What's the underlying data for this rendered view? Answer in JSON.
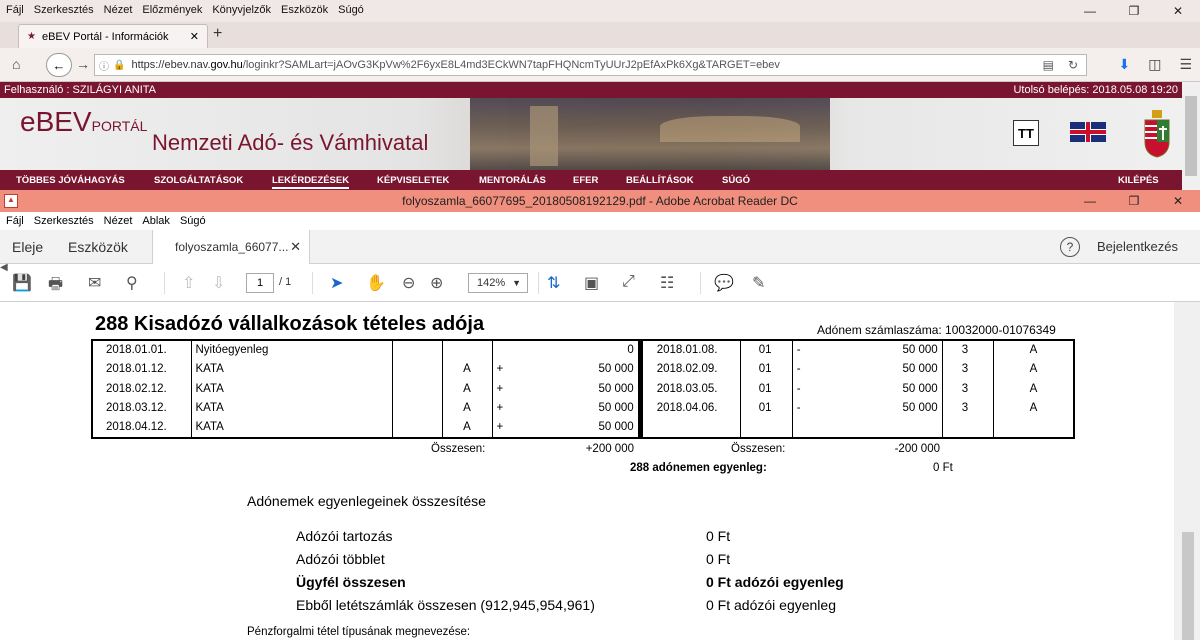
{
  "firefox": {
    "menu": [
      "Fájl",
      "Szerkesztés",
      "Nézet",
      "Előzmények",
      "Könyvjelzők",
      "Eszközök",
      "Súgó"
    ],
    "tab_title": "eBEV Portál - Információk",
    "url_prefix": "https://ebev.nav.",
    "url_host": "gov.hu",
    "url_rest": "/loginkr?SAMLart=jAOvG3KpVw%2F6yxE8L4md3ECkWN7tapFHQNcmTyUUrJ2pEfAxPk6Xg&TARGET=ebev"
  },
  "portal": {
    "user": "Felhasználó : SZILÁGYI ANITA",
    "last_login": "Utolsó belépés: 2018.05.08 19:20",
    "logo_main": "eBEV",
    "logo_sub": "PORTÁL",
    "agency": "Nemzeti Adó- és Vámhivatal",
    "font_button": "TT",
    "menu": [
      "TÖBBES JÓVÁHAGYÁS",
      "SZOLGÁLTATÁSOK",
      "LEKÉRDEZÉSEK",
      "KÉPVISELETEK",
      "MENTORÁLÁS",
      "EFER",
      "BEÁLLÍTÁSOK",
      "SÚGÓ"
    ],
    "logout": "KILÉPÉS",
    "accent": "#7a1530"
  },
  "acrobat": {
    "title": "folyoszamla_66077695_20180508192129.pdf - Adobe Acrobat Reader DC",
    "menu": [
      "Fájl",
      "Szerkesztés",
      "Nézet",
      "Ablak",
      "Súgó"
    ],
    "home": "Eleje",
    "tools": "Eszközök",
    "doc_tab": "folyoszamla_66077...",
    "login": "Bejelentkezés",
    "page_current": "1",
    "page_total": "/ 1",
    "zoom": "142%",
    "titlebar_color": "#f08f7e"
  },
  "document": {
    "title": "288 Kisadózó vállalkozások tételes adója",
    "account": "Adónem számlaszáma: 10032000-01076349",
    "rows": [
      {
        "date": "2018.01.01.",
        "desc": "Nyitóegyenleg",
        "a": "",
        "sign": "",
        "amount": "0",
        "date2": "2018.01.08.",
        "code": "01",
        "sign2": "-",
        "amount2": "50 000",
        "n": "3",
        "a2": "A"
      },
      {
        "date": "2018.01.12.",
        "desc": "KATA",
        "a": "A",
        "sign": "+",
        "amount": "50 000",
        "date2": "2018.02.09.",
        "code": "01",
        "sign2": "-",
        "amount2": "50 000",
        "n": "3",
        "a2": "A"
      },
      {
        "date": "2018.02.12.",
        "desc": "KATA",
        "a": "A",
        "sign": "+",
        "amount": "50 000",
        "date2": "2018.03.05.",
        "code": "01",
        "sign2": "-",
        "amount2": "50 000",
        "n": "3",
        "a2": "A"
      },
      {
        "date": "2018.03.12.",
        "desc": "KATA",
        "a": "A",
        "sign": "+",
        "amount": "50 000",
        "date2": "2018.04.06.",
        "code": "01",
        "sign2": "-",
        "amount2": "50 000",
        "n": "3",
        "a2": "A"
      },
      {
        "date": "2018.04.12.",
        "desc": "KATA",
        "a": "A",
        "sign": "+",
        "amount": "50 000",
        "date2": "",
        "code": "",
        "sign2": "",
        "amount2": "",
        "n": "",
        "a2": ""
      }
    ],
    "total_left_label": "Összesen:",
    "total_left_value": "+200 000",
    "total_right_label": "Összesen:",
    "total_right_value": "-200 000",
    "balance_label": "288 adónemen egyenleg:",
    "balance_value": "0 Ft",
    "summary_head": "Adónemek egyenlegeinek összesítése",
    "summary": [
      {
        "label": "Adózói tartozás",
        "value": "0 Ft",
        "bold": false
      },
      {
        "label": "Adózói többlet",
        "value": "0 Ft",
        "bold": false
      },
      {
        "label": "Ügyfél összesen",
        "value": "0 Ft adózói egyenleg",
        "bold": true
      },
      {
        "label": "Ebből letétszámlák összesen (912,945,954,961)",
        "value": "0 Ft adózói egyenleg",
        "bold": false
      }
    ],
    "footer_label": "Pénzforgalmi tétel típusának megnevezése:"
  }
}
